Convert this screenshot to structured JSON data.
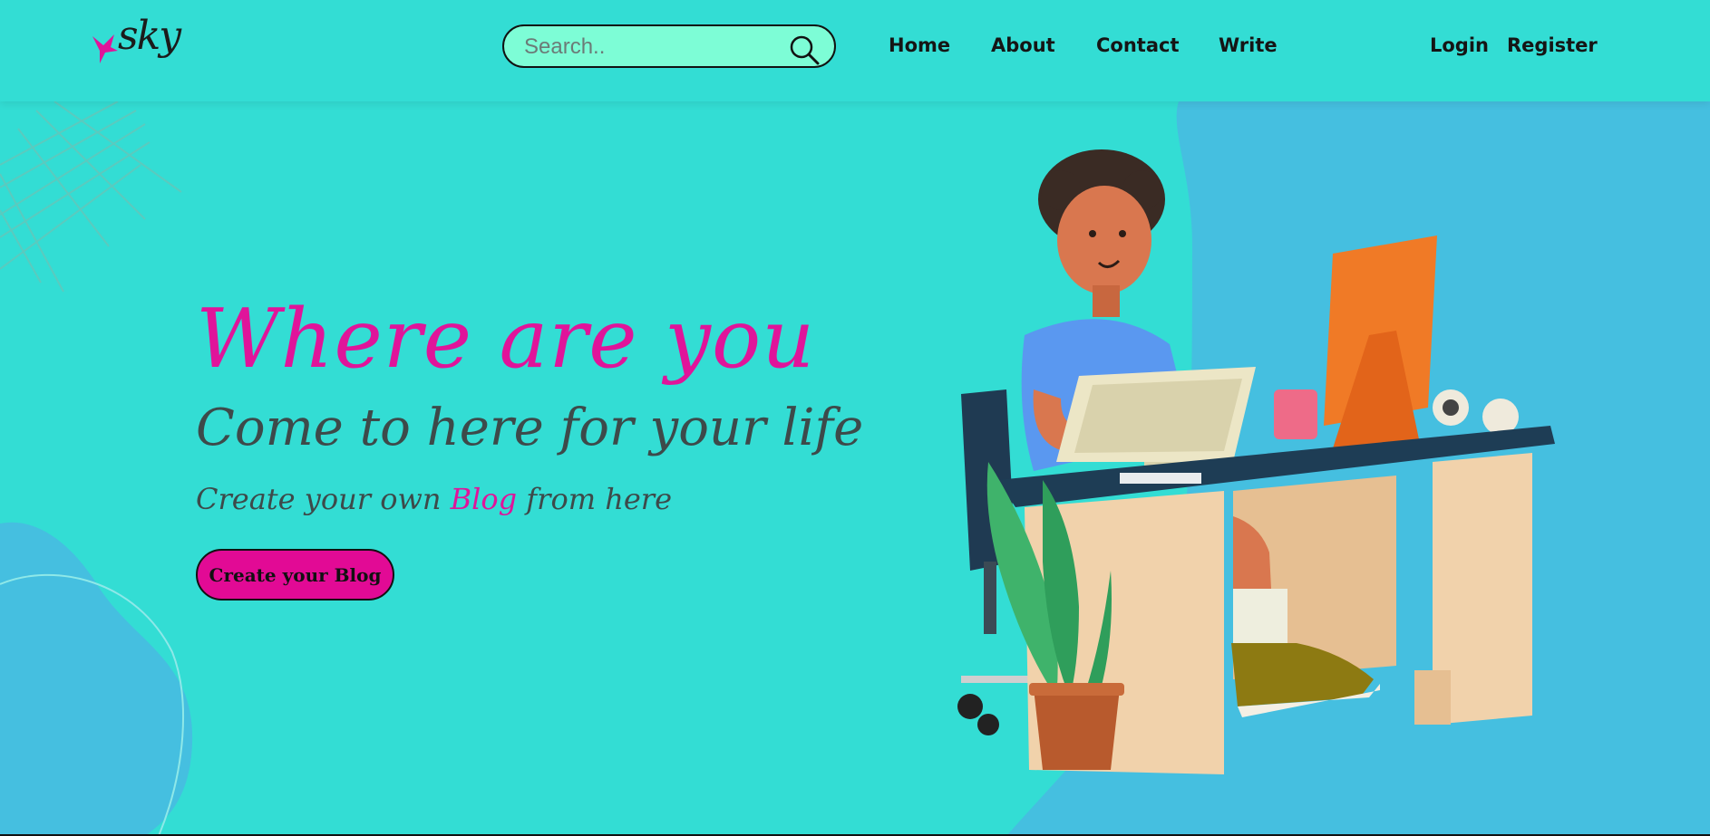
{
  "header": {
    "logo_text": "sky",
    "search": {
      "placeholder": "Search..",
      "value": ""
    },
    "nav": {
      "home": "Home",
      "about": "About",
      "contact": "Contact",
      "write": "Write",
      "login": "Login",
      "register": "Register"
    }
  },
  "hero": {
    "title": "Where are you",
    "subtitle": "Come to here for your life",
    "tagline_before": "Create your own ",
    "tagline_accent": "Blog",
    "tagline_after": " from here",
    "cta_label": "Create your Blog"
  },
  "colors": {
    "background": "#33ddd4",
    "accent_pink": "#e0149a",
    "search_fill": "#7dfdd6",
    "blob_blue": "#45bfe0",
    "text_dark": "#3d4a4a"
  },
  "icons": {
    "logo": "bird-logo-icon",
    "search": "search-icon",
    "illustration": "person-at-desk-illustration"
  }
}
